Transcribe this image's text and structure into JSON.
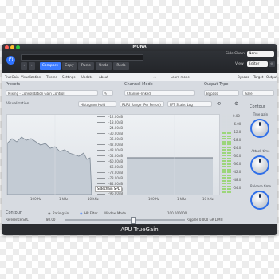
{
  "window": {
    "title": "MONA",
    "footer_title": "APU TrueGain"
  },
  "hostbar": {
    "side_chain_label": "Side Chain",
    "side_chain_value": "None",
    "view_label": "View",
    "view_value": "Editor",
    "buttons": [
      "Compare",
      "Copy",
      "Paste",
      "Undo",
      "Redo"
    ]
  },
  "plugin_tabs": [
    "TrueGain",
    "Visualization",
    "Theme",
    "Settings",
    "Update",
    "About"
  ],
  "plugin_right": [
    "Learn mode",
    "Bypass",
    "Target",
    "Output"
  ],
  "presets": {
    "label": "Presets",
    "value": "Mixing - Consolidation Gain Control"
  },
  "channel_mode": {
    "label": "Channel Mode",
    "value": "Channel-linked"
  },
  "output_type": {
    "label": "Output Type",
    "value": "Bypass"
  },
  "visualization": {
    "label": "Visualization",
    "options": [
      "Histogram Hold",
      "RLPU Range (Per Period)",
      "FFT Scale: Log"
    ],
    "scale": [
      "-12.00dB",
      "-18.00dB",
      "-24.00dB",
      "-30.00dB",
      "-36.00dB",
      "-42.00dB",
      "-48.00dB",
      "-54.00dB",
      "-60.00dB",
      "-66.00dB",
      "-72.00dB",
      "-78.00dB",
      "-84.00dB",
      "-90.00dB",
      "-96.00dB"
    ],
    "x_labels": [
      "100 Hz",
      "1 kHz",
      "10 kHz",
      "100 Hz",
      "1 kHz",
      "10 kHz"
    ],
    "right_scale": [
      "0.00",
      "-6.00",
      "-12.0",
      "-18.0",
      "-24.0",
      "-30.0",
      "-36.0",
      "-42.0",
      "-48.0",
      "-54.0"
    ],
    "tooltip": "Sidechain SPL"
  },
  "contour": {
    "label": "Contour",
    "knobs": [
      "True gain",
      "Attack time",
      "Release time"
    ]
  },
  "bottom": {
    "contour_label": "Contour",
    "opt1": "Ratio gain",
    "opt2": "HP Filter",
    "opt3": "Window Mode",
    "value_right": "100.000000",
    "ref_label": "Reference SPL",
    "ref_values": [
      "80.00",
      "-80.00"
    ],
    "status": "Ripples 0.000 GR LIMIT"
  },
  "colors": {
    "accent": "#2f73ff",
    "meter": "#9cd67a",
    "dark": "#2a2c30"
  }
}
